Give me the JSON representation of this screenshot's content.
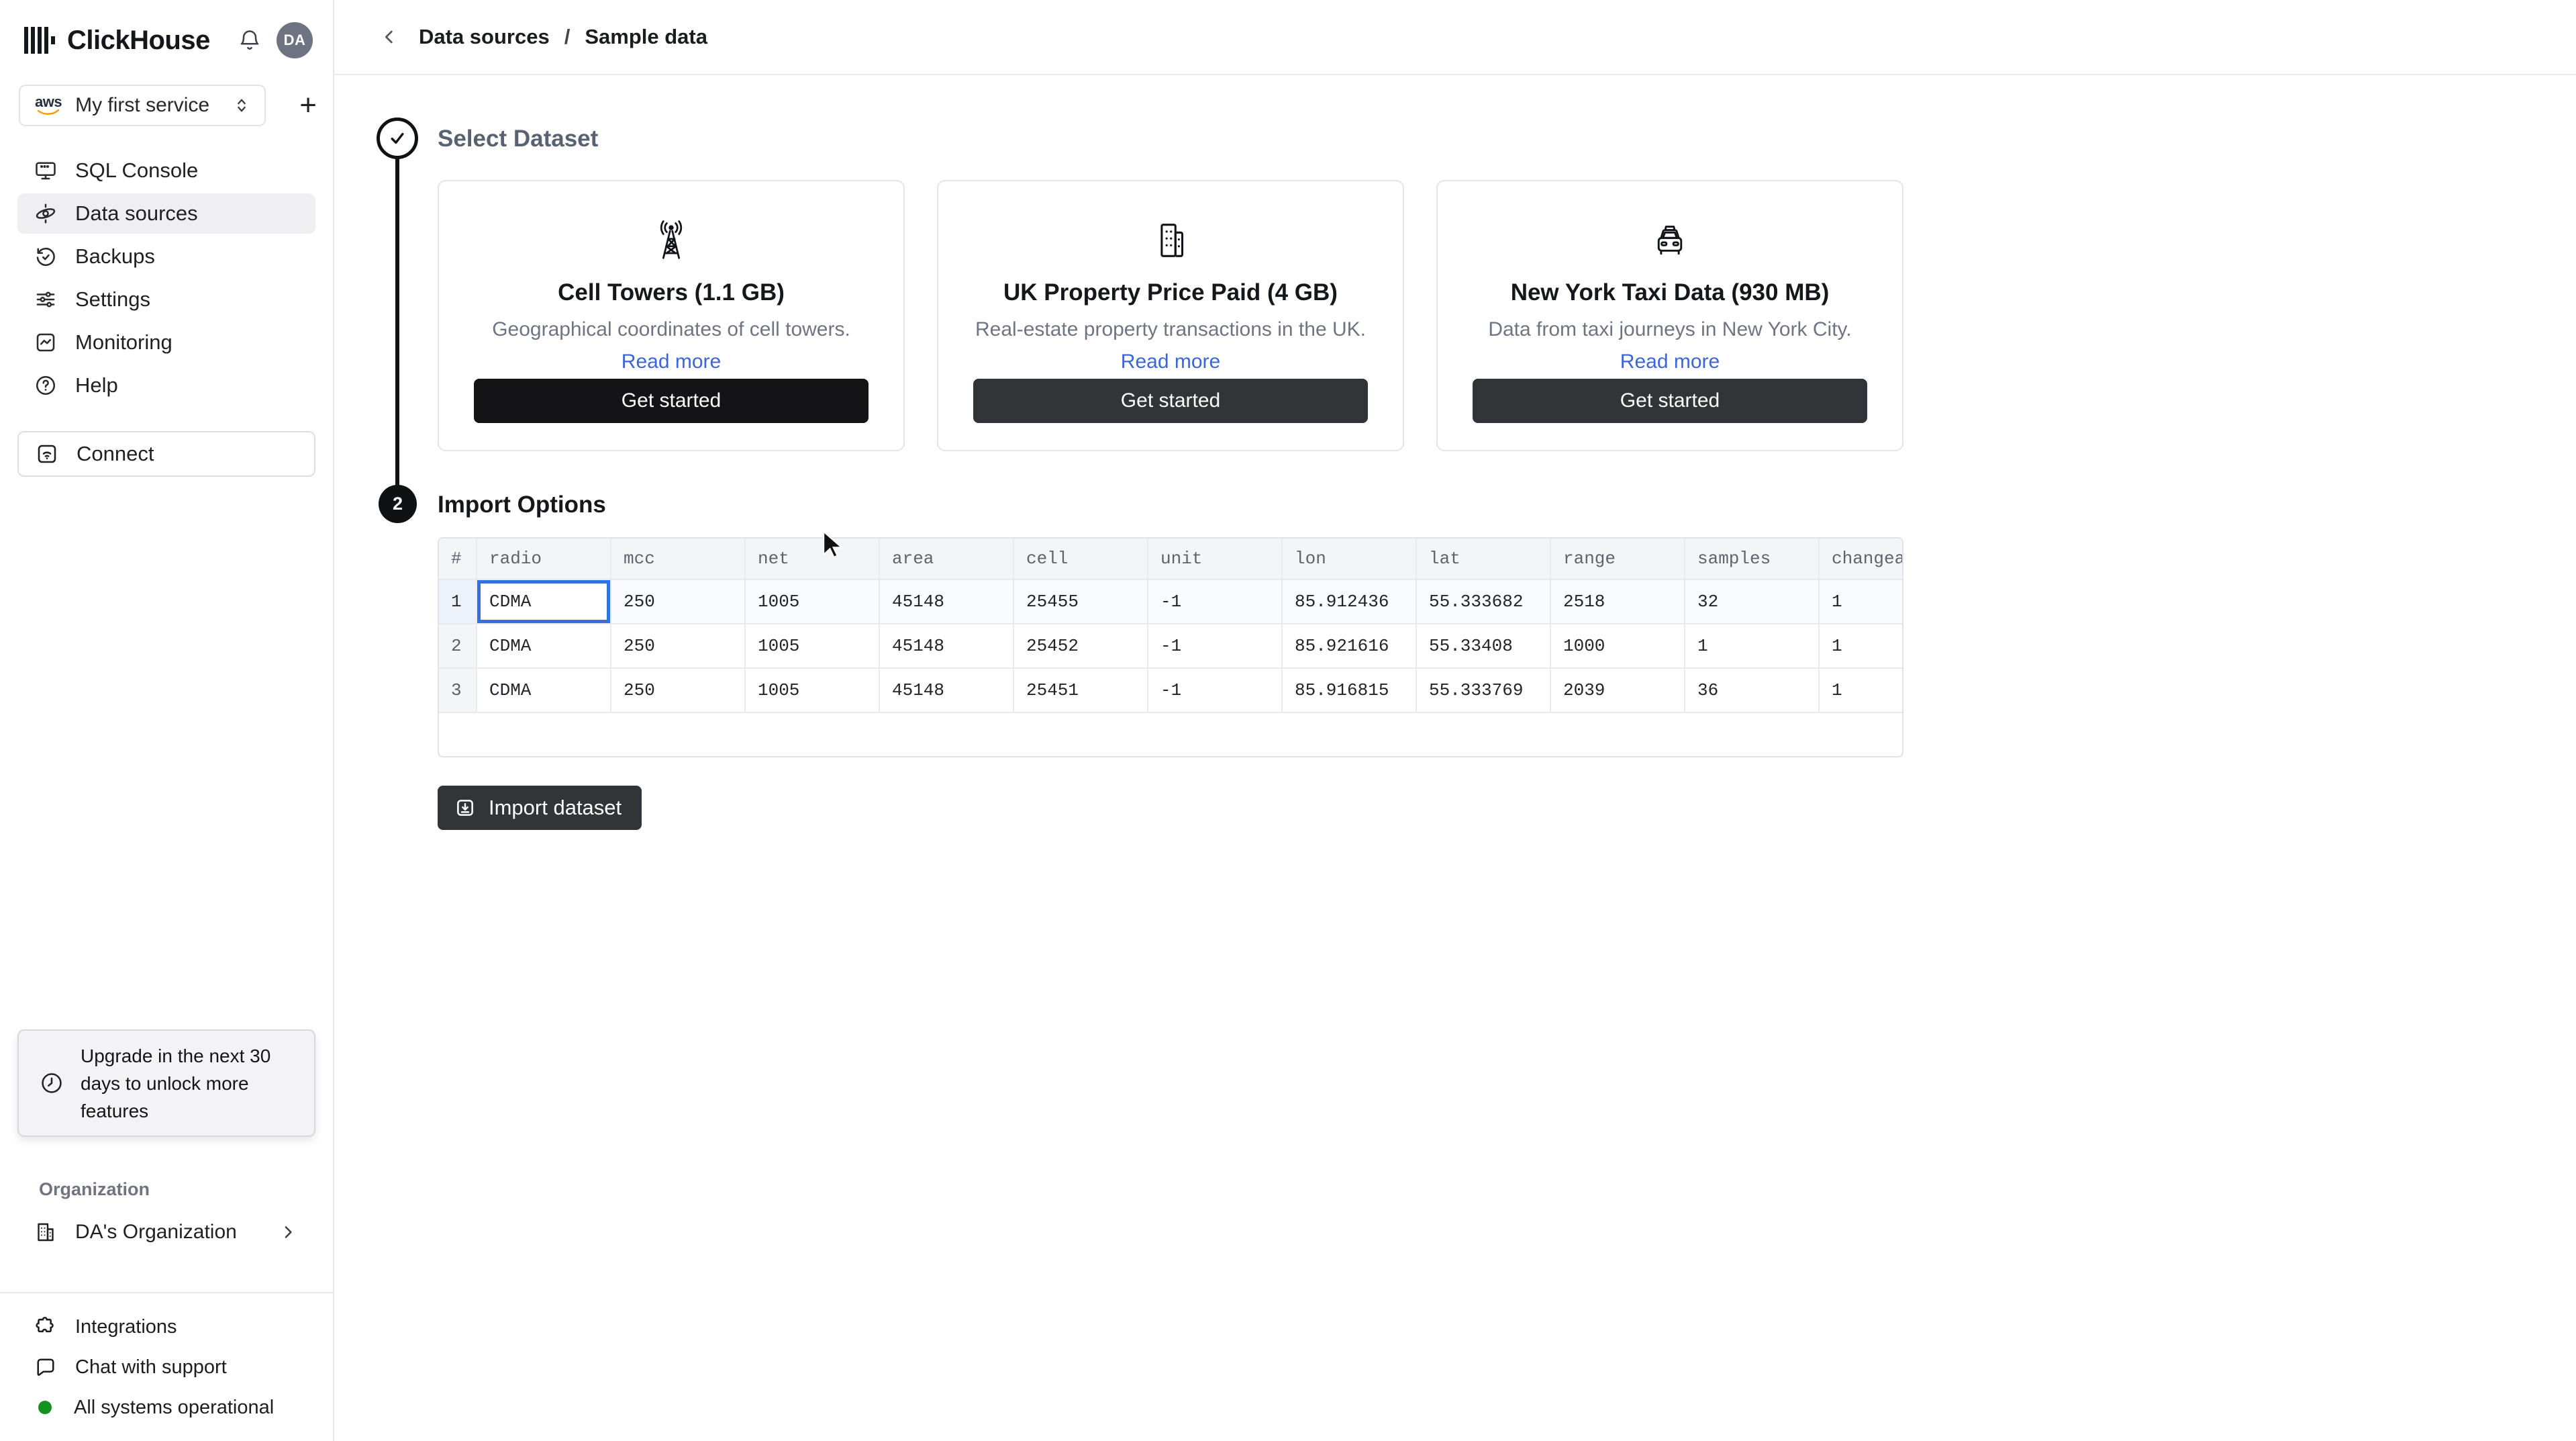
{
  "app": {
    "name": "ClickHouse"
  },
  "header": {
    "avatar_initials": "DA",
    "bell_icon": "bell-icon"
  },
  "service_selector": {
    "provider": "aws",
    "label": "My first service",
    "expander_icon": "up-down-chevron-icon",
    "add_icon": "plus-icon"
  },
  "sidebar": {
    "nav": [
      {
        "icon": "monitor-icon",
        "label": "SQL Console",
        "active": false
      },
      {
        "icon": "orbit-icon",
        "label": "Data sources",
        "active": true
      },
      {
        "icon": "history-icon",
        "label": "Backups",
        "active": false
      },
      {
        "icon": "sliders-icon",
        "label": "Settings",
        "active": false
      },
      {
        "icon": "chart-icon",
        "label": "Monitoring",
        "active": false
      },
      {
        "icon": "help-icon",
        "label": "Help",
        "active": false
      }
    ],
    "connect_label": "Connect",
    "connect_icon": "wifi-icon",
    "upgrade_notice": "Upgrade in the next 30 days to unlock more features",
    "upgrade_icon": "clock-icon",
    "organization_label": "Organization",
    "organization_name": "DA's Organization",
    "organization_icon": "building-icon",
    "footer": [
      {
        "icon": "puzzle-icon",
        "label": "Integrations"
      },
      {
        "icon": "chat-icon",
        "label": "Chat with support"
      },
      {
        "icon": "status-dot",
        "label": "All systems operational"
      }
    ]
  },
  "breadcrumb": {
    "back_icon": "chevron-left-icon",
    "items": [
      "Data sources",
      "Sample data"
    ],
    "separator": "/"
  },
  "steps": {
    "step1_icon": "check-icon",
    "step1_title": "Select Dataset",
    "step2_number": "2",
    "step2_title": "Import Options"
  },
  "datasets": {
    "cards": [
      {
        "icon": "cell-tower-icon",
        "title": "Cell Towers (1.1 GB)",
        "description": "Geographical coordinates of cell towers.",
        "link": "Read more",
        "button": "Get started",
        "button_style": "black"
      },
      {
        "icon": "buildings-icon",
        "title": "UK Property Price Paid (4 GB)",
        "description": "Real-estate property transactions in the UK.",
        "link": "Read more",
        "button": "Get started",
        "button_style": "dark"
      },
      {
        "icon": "taxi-icon",
        "title": "New York Taxi Data (930 MB)",
        "description": "Data from taxi journeys in New York City.",
        "link": "Read more",
        "button": "Get started",
        "button_style": "dark"
      }
    ]
  },
  "table": {
    "columns": [
      "#",
      "radio",
      "mcc",
      "net",
      "area",
      "cell",
      "unit",
      "lon",
      "lat",
      "range",
      "samples",
      "changeab"
    ],
    "rows": [
      [
        "1",
        "CDMA",
        "250",
        "1005",
        "45148",
        "25455",
        "-1",
        "85.912436",
        "55.333682",
        "2518",
        "32",
        "1"
      ],
      [
        "2",
        "CDMA",
        "250",
        "1005",
        "45148",
        "25452",
        "-1",
        "85.921616",
        "55.33408",
        "1000",
        "1",
        "1"
      ],
      [
        "3",
        "CDMA",
        "250",
        "1005",
        "45148",
        "25451",
        "-1",
        "85.916815",
        "55.333769",
        "2039",
        "36",
        "1"
      ]
    ],
    "selected_cell": {
      "row": 0,
      "col": 1
    }
  },
  "import_button": {
    "icon": "download-icon",
    "label": "Import dataset"
  },
  "colors": {
    "accent_blue": "#3471de",
    "link_blue": "#3b66d9",
    "status_green": "#12921f",
    "button_black": "#141417",
    "button_dark": "#333438",
    "active_nav_bg": "#efeff1",
    "table_header_bg": "#f4f5f7"
  }
}
